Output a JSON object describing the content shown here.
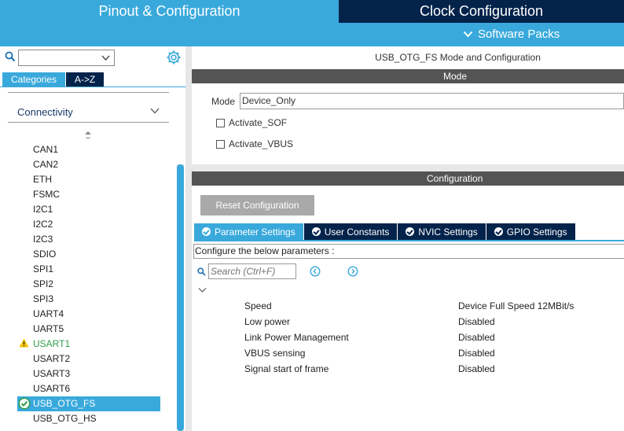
{
  "header": {
    "tab_pinout": "Pinout & Configuration",
    "tab_clock": "Clock Configuration",
    "software_packs": "Software Packs"
  },
  "left_panel": {
    "search_value": "",
    "tab_categories": "Categories",
    "tab_az": "A->Z",
    "category": "Connectivity",
    "peripherals": [
      {
        "label": "CAN1",
        "status": "none"
      },
      {
        "label": "CAN2",
        "status": "none"
      },
      {
        "label": "ETH",
        "status": "none"
      },
      {
        "label": "FSMC",
        "status": "none"
      },
      {
        "label": "I2C1",
        "status": "none"
      },
      {
        "label": "I2C2",
        "status": "none"
      },
      {
        "label": "I2C3",
        "status": "none"
      },
      {
        "label": "SDIO",
        "status": "none"
      },
      {
        "label": "SPI1",
        "status": "none"
      },
      {
        "label": "SPI2",
        "status": "none"
      },
      {
        "label": "SPI3",
        "status": "none"
      },
      {
        "label": "UART4",
        "status": "none"
      },
      {
        "label": "UART5",
        "status": "none"
      },
      {
        "label": "USART1",
        "status": "warning"
      },
      {
        "label": "USART2",
        "status": "none"
      },
      {
        "label": "USART3",
        "status": "none"
      },
      {
        "label": "USART6",
        "status": "none"
      },
      {
        "label": "USB_OTG_FS",
        "status": "selected-ok"
      },
      {
        "label": "USB_OTG_HS",
        "status": "none"
      }
    ]
  },
  "mode_section": {
    "title": "USB_OTG_FS Mode and Configuration",
    "bar_label": "Mode",
    "mode_label": "Mode",
    "mode_value": "Device_Only",
    "activate_sof": {
      "label": "Activate_SOF",
      "checked": false
    },
    "activate_vbus": {
      "label": "Activate_VBUS",
      "checked": false
    }
  },
  "config_section": {
    "bar_label": "Configuration",
    "reset_button": "Reset Configuration",
    "tabs": [
      "Parameter Settings",
      "User Constants",
      "NVIC Settings",
      "GPIO Settings"
    ],
    "active_tab": "Parameter Settings",
    "instructions": "Configure the below parameters :",
    "search_placeholder": "Search (Ctrl+F)",
    "parameters": [
      {
        "name": "Speed",
        "value": "Device Full Speed 12MBit/s"
      },
      {
        "name": "Low power",
        "value": "Disabled"
      },
      {
        "name": "Link Power Management",
        "value": "Disabled"
      },
      {
        "name": "VBUS sensing",
        "value": "Disabled"
      },
      {
        "name": "Signal start of frame",
        "value": "Disabled"
      }
    ]
  },
  "colors": {
    "accent_blue": "#39a9dc",
    "navy": "#03234b",
    "dark_bar": "#545454",
    "warning_green_text": "#2e9e4a",
    "warning_yellow": "#f5c400",
    "ok_green": "#2e9e4a"
  },
  "icons": {
    "search": "search-icon",
    "gear": "gear-icon",
    "chevron_down": "chevron-down-icon",
    "sort": "sort-icon",
    "warning": "warning-icon",
    "check": "check-circle-icon",
    "nav_prev": "prev-circle-icon",
    "nav_next": "next-circle-icon"
  }
}
